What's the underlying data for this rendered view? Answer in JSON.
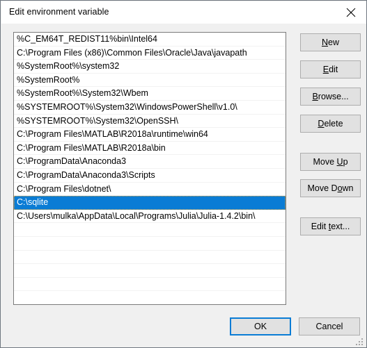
{
  "window": {
    "title": "Edit environment variable",
    "close_icon": "close-icon",
    "accent_color": "#0a7cd5",
    "body_background": "#f0f0f0",
    "titlebar_background": "#ffffff",
    "button_background": "#e1e1e1"
  },
  "list": {
    "selected_index": 12,
    "items": [
      "%C_EM64T_REDIST11%bin\\Intel64",
      "C:\\Program Files (x86)\\Common Files\\Oracle\\Java\\javapath",
      "%SystemRoot%\\system32",
      "%SystemRoot%",
      "%SystemRoot%\\System32\\Wbem",
      "%SYSTEMROOT%\\System32\\WindowsPowerShell\\v1.0\\",
      "%SYSTEMROOT%\\System32\\OpenSSH\\",
      "C:\\Program Files\\MATLAB\\R2018a\\runtime\\win64",
      "C:\\Program Files\\MATLAB\\R2018a\\bin",
      "C:\\ProgramData\\Anaconda3",
      "C:\\ProgramData\\Anaconda3\\Scripts",
      "C:\\Program Files\\dotnet\\",
      "C:\\sqlite",
      "C:\\Users\\mulka\\AppData\\Local\\Programs\\Julia\\Julia-1.4.2\\bin\\"
    ],
    "empty_row_count": 6
  },
  "side_buttons": {
    "new": {
      "pre": "",
      "accel": "N",
      "post": "ew"
    },
    "edit": {
      "pre": "",
      "accel": "E",
      "post": "dit"
    },
    "browse": {
      "pre": "",
      "accel": "B",
      "post": "rowse..."
    },
    "delete": {
      "pre": "",
      "accel": "D",
      "post": "elete"
    },
    "move_up": {
      "pre": "Move ",
      "accel": "U",
      "post": "p"
    },
    "move_down": {
      "pre": "Move D",
      "accel": "o",
      "post": "wn"
    },
    "edit_text": {
      "pre": "Edit ",
      "accel": "t",
      "post": "ext..."
    }
  },
  "footer": {
    "ok_label": "OK",
    "cancel_label": "Cancel",
    "resize_grip": "resize-grip-icon"
  }
}
